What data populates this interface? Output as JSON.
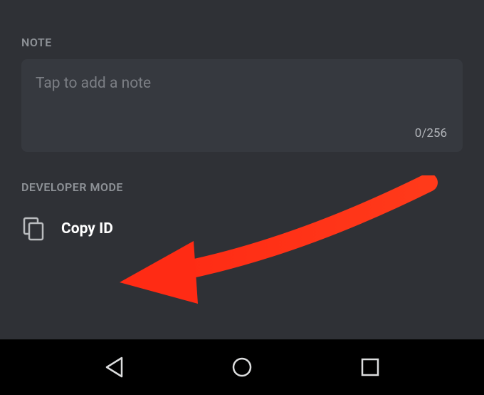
{
  "note": {
    "header": "NOTE",
    "placeholder": "Tap to add a note",
    "count": "0/256"
  },
  "developer": {
    "header": "DEVELOPER MODE",
    "copy_label": "Copy ID"
  }
}
